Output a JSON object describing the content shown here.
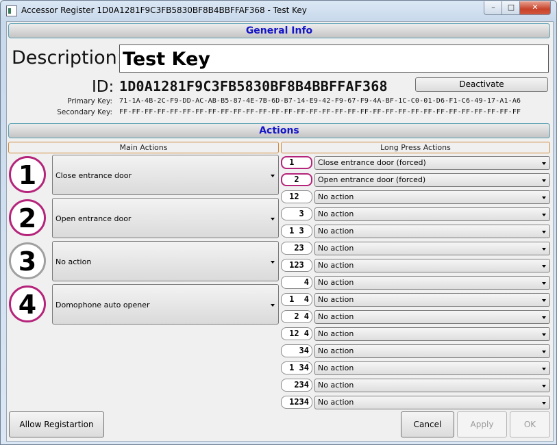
{
  "window": {
    "title": "Accessor Register 1D0A1281F9C3FB5830BF8B4BBFFAF368 - Test Key",
    "minimize": "–",
    "maximize": "□",
    "close": "✕"
  },
  "general": {
    "header": "General Info",
    "description_label": "Description:",
    "description_value": "Test Key",
    "id_label": "ID:",
    "id_value": "1D0A1281F9C3FB5830BF8B4BBFFAF368",
    "deactivate_label": "Deactivate",
    "primary_key_label": "Primary Key:",
    "primary_key_value": "71-1A-4B-2C-F9-DD-AC-AB-B5-87-4E-7B-6D-B7-14-E9-42-F9-67-F9-4A-BF-1C-C0-01-D6-F1-C6-49-17-A1-A6",
    "secondary_key_label": "Secondary Key:",
    "secondary_key_value": "FF-FF-FF-FF-FF-FF-FF-FF-FF-FF-FF-FF-FF-FF-FF-FF-FF-FF-FF-FF-FF-FF-FF-FF-FF-FF-FF-FF-FF-FF-FF-FF"
  },
  "actions": {
    "header": "Actions",
    "main_header": "Main Actions",
    "long_header": "Long Press Actions",
    "main": [
      {
        "num": "1",
        "value": "Close entrance door"
      },
      {
        "num": "2",
        "value": "Open entrance door"
      },
      {
        "num": "3",
        "value": "No action"
      },
      {
        "num": "4",
        "value": "Domophone auto opener"
      }
    ],
    "long": [
      {
        "combo": "1   ",
        "value": "Close entrance door (forced)"
      },
      {
        "combo": "2  ",
        "value": "Open entrance door (forced)"
      },
      {
        "combo": "12  ",
        "value": "No action"
      },
      {
        "combo": "3 ",
        "value": "No action"
      },
      {
        "combo": "1 3 ",
        "value": "No action"
      },
      {
        "combo": "23 ",
        "value": "No action"
      },
      {
        "combo": "123 ",
        "value": "No action"
      },
      {
        "combo": "4",
        "value": "No action"
      },
      {
        "combo": "1  4",
        "value": "No action"
      },
      {
        "combo": "2 4",
        "value": "No action"
      },
      {
        "combo": "12 4",
        "value": "No action"
      },
      {
        "combo": "34",
        "value": "No action"
      },
      {
        "combo": "1 34",
        "value": "No action"
      },
      {
        "combo": "234",
        "value": "No action"
      },
      {
        "combo": "1234",
        "value": "No action"
      }
    ]
  },
  "footer": {
    "allow_label": "Allow Registartion",
    "cancel_label": "Cancel",
    "apply_label": "Apply",
    "ok_label": "OK"
  }
}
